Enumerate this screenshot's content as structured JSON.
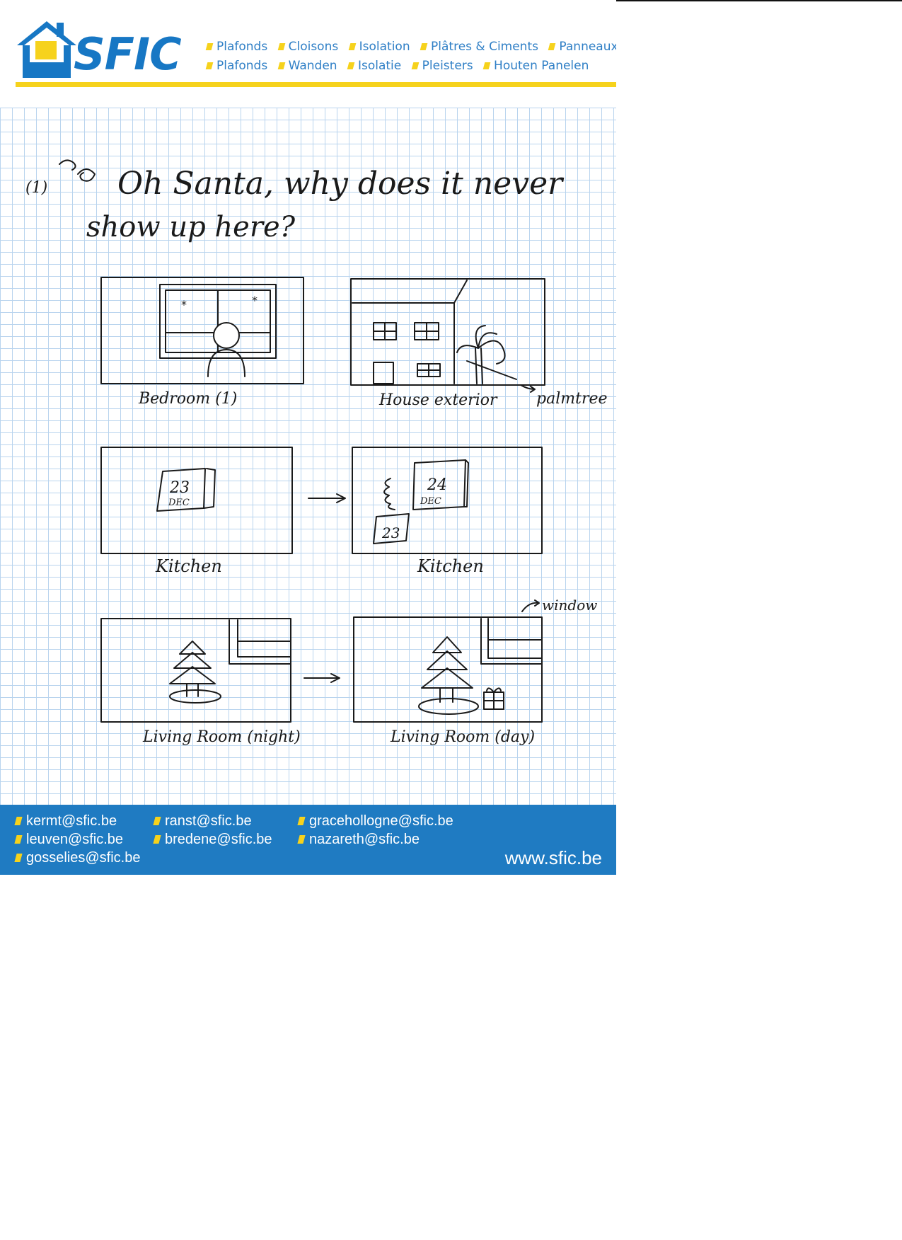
{
  "header": {
    "logo_text": "SFIC",
    "services_fr": [
      "Plafonds",
      "Cloisons",
      "Isolation",
      "Plâtres & Ciments",
      "Panneaux"
    ],
    "services_nl": [
      "Plafonds",
      "Wanden",
      "Isolatie",
      "Pleisters",
      "Houten Panelen"
    ]
  },
  "note": {
    "number": "(1)",
    "line1": "Oh Santa, why does it never",
    "line2": "show up here?"
  },
  "panels": [
    {
      "caption": "Bedroom (1)"
    },
    {
      "caption": "House exterior",
      "annotation": "palmtree"
    },
    {
      "caption": "Kitchen",
      "calendar_day": "23",
      "calendar_month": "DEC"
    },
    {
      "caption": "Kitchen",
      "calendar_day": "24",
      "calendar_month": "DEC",
      "torn_page": "23"
    },
    {
      "caption": "Living Room (night)"
    },
    {
      "caption": "Living Room (day)",
      "annotation": "window"
    }
  ],
  "arrow": "→",
  "footer": {
    "emails": [
      "kermt@sfic.be",
      "leuven@sfic.be",
      "gosselies@sfic.be",
      "ranst@sfic.be",
      "bredene@sfic.be",
      "gracehollogne@sfic.be",
      "nazareth@sfic.be"
    ],
    "website": "www.sfic.be"
  },
  "colors": {
    "brand_blue": "#1777c4",
    "brand_yellow": "#f6d21c",
    "footer_blue": "#1f7bc2",
    "grid_line": "#b9d4ee"
  }
}
